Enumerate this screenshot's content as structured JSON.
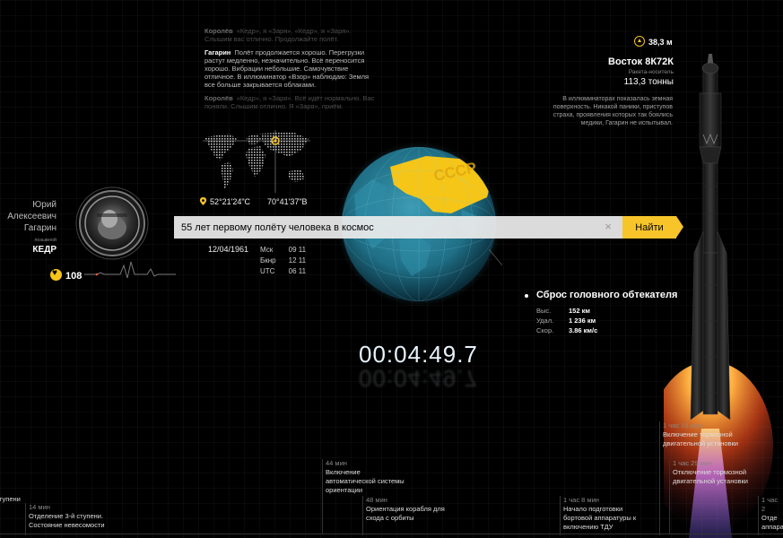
{
  "radio_log": [
    {
      "speaker": "Королёв",
      "text": "«Кедр», я «Заря». «Кедр», я «Заря». Слышим вас отлично. Продолжайте полёт.",
      "style": "dim"
    },
    {
      "speaker": "Гагарин",
      "text": "Полёт продолжается хорошо. Перегрузки растут медленно, незначительно. Всё переносится хорошо. Вибрации небольшие. Самочувствие отличное. В иллюминатор «Взор» наблюдаю: Земля все больше закрывается облаками.",
      "style": "bright"
    },
    {
      "speaker": "Королёв",
      "text": "«Кедр», я «Заря». Всё идёт нормально. Вас поняли. Слышим отлично. Я «Заря», приём.",
      "style": "dim"
    }
  ],
  "location": {
    "lat": "52°21'24\"С",
    "lon": "70°41'37\"В"
  },
  "pilot": {
    "first_name": "Юрий",
    "patronymic": "Алексеевич",
    "last_name": "Гагарин",
    "callsign_label": "позывной",
    "callsign": "КЕДР",
    "pulse": "108"
  },
  "clock": {
    "date": "12/04/1961",
    "rows": [
      {
        "zone": "Мск",
        "time": "09 11"
      },
      {
        "zone": "Бкнр",
        "time": "12 11"
      },
      {
        "zone": "UTC",
        "time": "06 11"
      }
    ]
  },
  "search": {
    "value": "55 лет первому полёту человека в космос",
    "button": "Найти"
  },
  "globe_label": "СССР",
  "event": {
    "title": "Сброс головного обтекателя",
    "stats": [
      {
        "k": "Выс.",
        "v": "152 км"
      },
      {
        "k": "Удал.",
        "v": "1 236 км"
      },
      {
        "k": "Скор.",
        "v": "3.86 км/с"
      }
    ]
  },
  "timer": "00:04:49.7",
  "rocket": {
    "altitude": "38,3 м",
    "name": "Восток 8К72К",
    "type": "Ракета-носитель",
    "mass": "113,3 тонны",
    "description": "В иллюминаторах показалась земная поверхность. Никакой паники, приступов страха, проявления которых так боялись медики, Гагарин не испытывал."
  },
  "timeline": [
    {
      "time": "",
      "label": "тупени"
    },
    {
      "time": "14 мин",
      "label": "Отделение 3-й ступени. Состояние невесомости"
    },
    {
      "time": "44 мин",
      "label": "Включение автоматической системы ориентации"
    },
    {
      "time": "48 мин",
      "label": "Ориентация корабля для схода с орбиты"
    },
    {
      "time": "1 час 8 мин",
      "label": "Начало подготовки бортовой аппаратуры к включению ТДУ"
    },
    {
      "time": "1 час 18 мин",
      "label": "Включение тормозной двигательной установки"
    },
    {
      "time": "1 час 29 мин",
      "label": "Отключение тормозной двигательной установки"
    },
    {
      "time": "1 час 2",
      "label": "Отде аппара"
    }
  ],
  "colors": {
    "accent": "#f7c52a",
    "background": "#000000",
    "globe_ocean": "#1f6f86"
  }
}
